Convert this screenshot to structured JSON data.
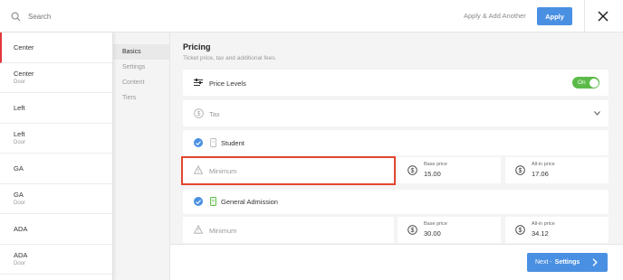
{
  "search": {
    "placeholder": "Search"
  },
  "toolbar": {
    "apply_another_label": "Apply & Add Another",
    "apply_label": "Apply"
  },
  "sections": [
    {
      "name": "Center",
      "sub": ""
    },
    {
      "name": "Center",
      "sub": "Door"
    },
    {
      "name": "Left",
      "sub": ""
    },
    {
      "name": "Left",
      "sub": "Door"
    },
    {
      "name": "GA",
      "sub": ""
    },
    {
      "name": "GA",
      "sub": "Door"
    },
    {
      "name": "ADA",
      "sub": ""
    },
    {
      "name": "ADA",
      "sub": "Door"
    }
  ],
  "subnav": {
    "items": [
      "Basics",
      "Settings",
      "Content",
      "Tiers"
    ],
    "active": "Basics"
  },
  "pricing": {
    "title": "Pricing",
    "subtitle": "Ticket price, tax and additional fees.",
    "price_levels_label": "Price Levels",
    "toggle_label": "On",
    "tax_label": "Tax",
    "levels": [
      {
        "name": "Student",
        "minimum_placeholder": "Minimum",
        "base_label": "Base price",
        "base_value": "15.00",
        "allin_label": "All-in price",
        "allin_value": "17.06"
      },
      {
        "name": "General Admission",
        "minimum_placeholder": "Minimum",
        "base_label": "Base price",
        "base_value": "30.00",
        "allin_label": "All-in price",
        "allin_value": "34.12"
      }
    ]
  },
  "footer": {
    "next_label": "Next -",
    "next_target": "Settings"
  },
  "colors": {
    "accent": "#4a90e2",
    "toggle_on": "#5cbb48",
    "selected_marker": "#e1363b",
    "highlight": "#e2462f"
  }
}
